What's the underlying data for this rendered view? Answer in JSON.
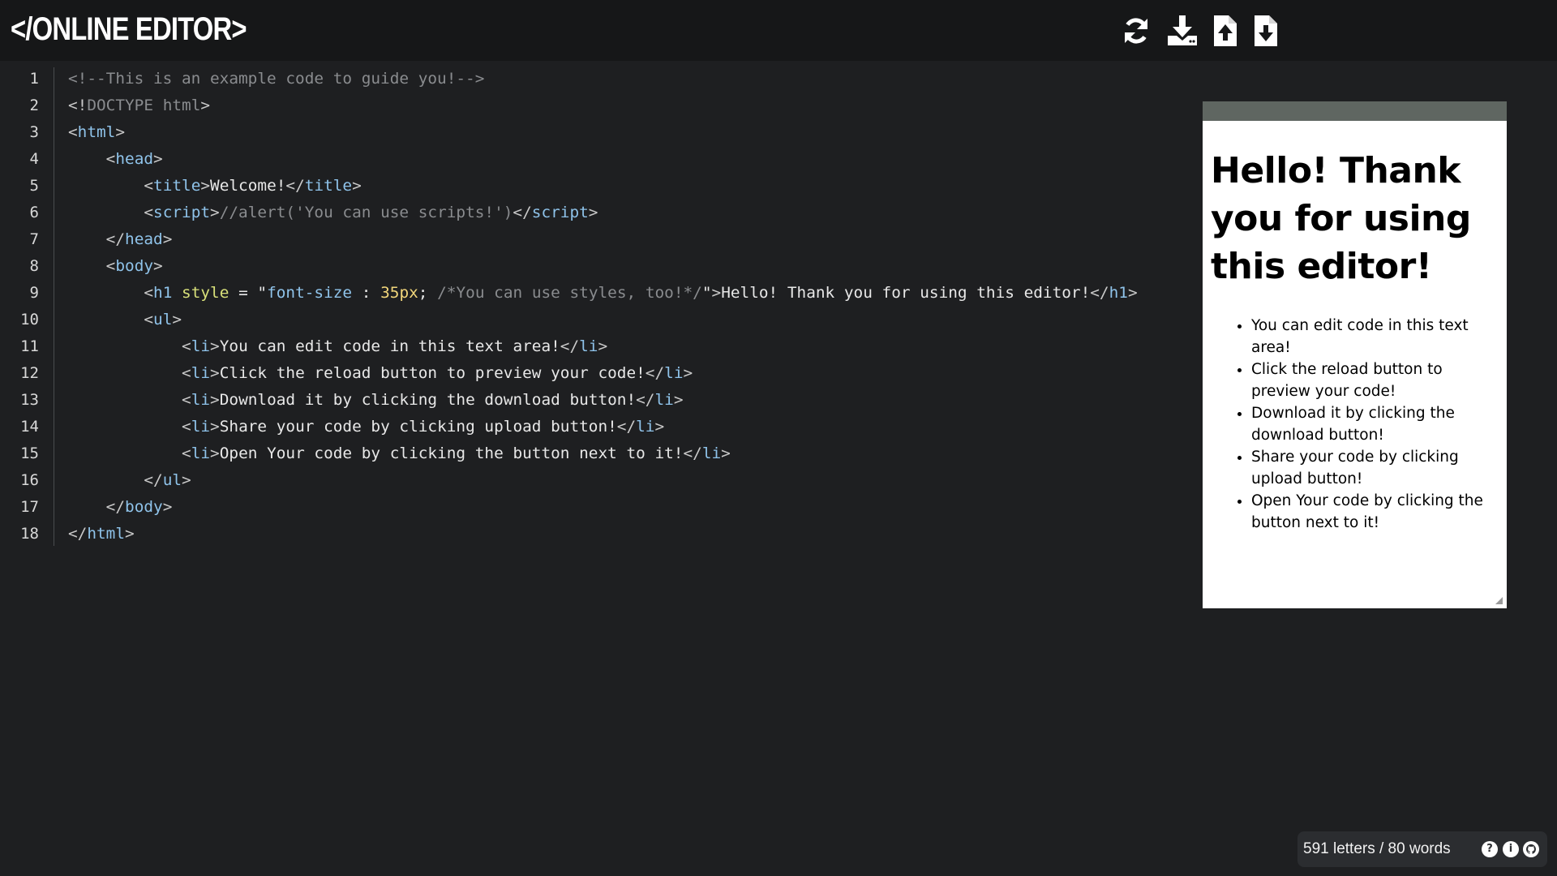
{
  "app": {
    "logo": "</ONLINE EDITOR>"
  },
  "toolbar": {
    "buttons": [
      {
        "name": "reload",
        "icon": "reload-icon"
      },
      {
        "name": "download",
        "icon": "download-icon"
      },
      {
        "name": "upload",
        "icon": "file-upload-icon"
      },
      {
        "name": "open",
        "icon": "file-download-icon"
      }
    ]
  },
  "editor": {
    "line_numbers": [
      "1",
      "2",
      "3",
      "4",
      "5",
      "6",
      "7",
      "8",
      "9",
      "10",
      "11",
      "12",
      "13",
      "14",
      "15",
      "16",
      "17",
      "18"
    ],
    "lines": [
      [
        {
          "t": "cm",
          "v": "<!--This is an example code to guide you!-->"
        }
      ],
      [
        {
          "t": "pun",
          "v": "<!"
        },
        {
          "t": "cm",
          "v": "DOCTYPE html"
        },
        {
          "t": "pun",
          "v": ">"
        }
      ],
      [
        {
          "t": "pun",
          "v": "<"
        },
        {
          "t": "tag",
          "v": "html"
        },
        {
          "t": "pun",
          "v": ">"
        }
      ],
      [
        {
          "t": "txt",
          "v": "    "
        },
        {
          "t": "pun",
          "v": "<"
        },
        {
          "t": "tag",
          "v": "head"
        },
        {
          "t": "pun",
          "v": ">"
        }
      ],
      [
        {
          "t": "txt",
          "v": "        "
        },
        {
          "t": "pun",
          "v": "<"
        },
        {
          "t": "tag",
          "v": "title"
        },
        {
          "t": "pun",
          "v": ">"
        },
        {
          "t": "txt",
          "v": "Welcome!"
        },
        {
          "t": "pun",
          "v": "</"
        },
        {
          "t": "tag",
          "v": "title"
        },
        {
          "t": "pun",
          "v": ">"
        }
      ],
      [
        {
          "t": "txt",
          "v": "        "
        },
        {
          "t": "pun",
          "v": "<"
        },
        {
          "t": "tag",
          "v": "script"
        },
        {
          "t": "pun",
          "v": ">"
        },
        {
          "t": "cm",
          "v": "//alert('You can use scripts!')"
        },
        {
          "t": "pun",
          "v": "</"
        },
        {
          "t": "tag",
          "v": "script"
        },
        {
          "t": "pun",
          "v": ">"
        }
      ],
      [
        {
          "t": "txt",
          "v": "    "
        },
        {
          "t": "pun",
          "v": "</"
        },
        {
          "t": "tag",
          "v": "head"
        },
        {
          "t": "pun",
          "v": ">"
        }
      ],
      [
        {
          "t": "txt",
          "v": "    "
        },
        {
          "t": "pun",
          "v": "<"
        },
        {
          "t": "tag",
          "v": "body"
        },
        {
          "t": "pun",
          "v": ">"
        }
      ],
      [
        {
          "t": "txt",
          "v": "        "
        },
        {
          "t": "pun",
          "v": "<"
        },
        {
          "t": "tag",
          "v": "h1"
        },
        {
          "t": "txt",
          "v": " "
        },
        {
          "t": "attr",
          "v": "style"
        },
        {
          "t": "txt",
          "v": " = \""
        },
        {
          "t": "str",
          "v": "font-size"
        },
        {
          "t": "txt",
          "v": " : "
        },
        {
          "t": "num",
          "v": "35px"
        },
        {
          "t": "txt",
          "v": "; "
        },
        {
          "t": "cm",
          "v": "/*You can use styles, too!*/"
        },
        {
          "t": "txt",
          "v": "\""
        },
        {
          "t": "pun",
          "v": ">"
        },
        {
          "t": "txt",
          "v": "Hello! Thank you for using this editor!"
        },
        {
          "t": "pun",
          "v": "</"
        },
        {
          "t": "tag",
          "v": "h1"
        },
        {
          "t": "pun",
          "v": ">"
        }
      ],
      [
        {
          "t": "txt",
          "v": "        "
        },
        {
          "t": "pun",
          "v": "<"
        },
        {
          "t": "tag",
          "v": "ul"
        },
        {
          "t": "pun",
          "v": ">"
        }
      ],
      [
        {
          "t": "txt",
          "v": "            "
        },
        {
          "t": "pun",
          "v": "<"
        },
        {
          "t": "tag",
          "v": "li"
        },
        {
          "t": "pun",
          "v": ">"
        },
        {
          "t": "txt",
          "v": "You can edit code in this text area!"
        },
        {
          "t": "pun",
          "v": "</"
        },
        {
          "t": "tag",
          "v": "li"
        },
        {
          "t": "pun",
          "v": ">"
        }
      ],
      [
        {
          "t": "txt",
          "v": "            "
        },
        {
          "t": "pun",
          "v": "<"
        },
        {
          "t": "tag",
          "v": "li"
        },
        {
          "t": "pun",
          "v": ">"
        },
        {
          "t": "txt",
          "v": "Click the reload button to preview your code!"
        },
        {
          "t": "pun",
          "v": "</"
        },
        {
          "t": "tag",
          "v": "li"
        },
        {
          "t": "pun",
          "v": ">"
        }
      ],
      [
        {
          "t": "txt",
          "v": "            "
        },
        {
          "t": "pun",
          "v": "<"
        },
        {
          "t": "tag",
          "v": "li"
        },
        {
          "t": "pun",
          "v": ">"
        },
        {
          "t": "txt",
          "v": "Download it by clicking the download button!"
        },
        {
          "t": "pun",
          "v": "</"
        },
        {
          "t": "tag",
          "v": "li"
        },
        {
          "t": "pun",
          "v": ">"
        }
      ],
      [
        {
          "t": "txt",
          "v": "            "
        },
        {
          "t": "pun",
          "v": "<"
        },
        {
          "t": "tag",
          "v": "li"
        },
        {
          "t": "pun",
          "v": ">"
        },
        {
          "t": "txt",
          "v": "Share your code by clicking upload button!"
        },
        {
          "t": "pun",
          "v": "</"
        },
        {
          "t": "tag",
          "v": "li"
        },
        {
          "t": "pun",
          "v": ">"
        }
      ],
      [
        {
          "t": "txt",
          "v": "            "
        },
        {
          "t": "pun",
          "v": "<"
        },
        {
          "t": "tag",
          "v": "li"
        },
        {
          "t": "pun",
          "v": ">"
        },
        {
          "t": "txt",
          "v": "Open Your code by clicking the button next to it!"
        },
        {
          "t": "pun",
          "v": "</"
        },
        {
          "t": "tag",
          "v": "li"
        },
        {
          "t": "pun",
          "v": ">"
        }
      ],
      [
        {
          "t": "txt",
          "v": "        "
        },
        {
          "t": "pun",
          "v": "</"
        },
        {
          "t": "tag",
          "v": "ul"
        },
        {
          "t": "pun",
          "v": ">"
        }
      ],
      [
        {
          "t": "txt",
          "v": "    "
        },
        {
          "t": "pun",
          "v": "</"
        },
        {
          "t": "tag",
          "v": "body"
        },
        {
          "t": "pun",
          "v": ">"
        }
      ],
      [
        {
          "t": "pun",
          "v": "</"
        },
        {
          "t": "tag",
          "v": "html"
        },
        {
          "t": "pun",
          "v": ">"
        }
      ]
    ]
  },
  "preview": {
    "heading": "Hello! Thank you for using this editor!",
    "items": [
      "You can edit code in this text area!",
      "Click the reload button to preview your code!",
      "Download it by clicking the download button!",
      "Share your code by clicking upload button!",
      "Open Your code by clicking the button next to it!"
    ]
  },
  "status": {
    "counts": "591 letters / 80 words",
    "icons": [
      "help-icon",
      "info-icon",
      "github-icon"
    ]
  },
  "colors": {
    "background": "#1e1f21",
    "topbar": "#161718",
    "tag": "#8fc3ea",
    "comment": "#8a8c8f",
    "attribute": "#d8e07a",
    "number": "#f2d67b",
    "preview_bar": "#5f6661"
  }
}
